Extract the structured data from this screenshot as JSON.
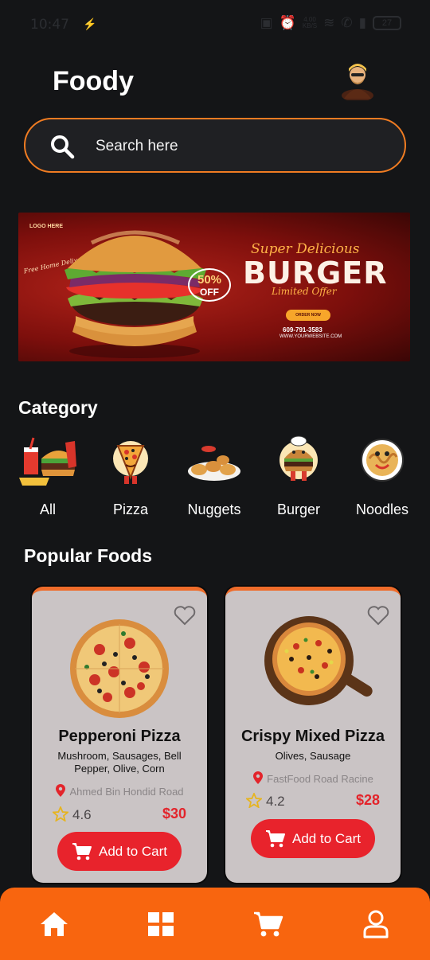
{
  "status_bar": {
    "time": "10:47",
    "speed": "4.00\nKB/S",
    "battery": "27"
  },
  "header": {
    "title": "Foody"
  },
  "search": {
    "placeholder": "Search here"
  },
  "banner": {
    "logo": "LOGO HERE",
    "free_delivery": "Free Home Delivery",
    "discount_pct": "50%",
    "discount_word": "OFF",
    "super": "Super Delicious",
    "headline": "BURGER",
    "subline": "Limited Offer",
    "cta": "ORDER NOW",
    "phone": "609-791-3583",
    "website": "WWW.YOURWEBSITE.COM"
  },
  "category": {
    "title": "Category",
    "items": [
      {
        "label": "All",
        "icon": "combo-meal-icon"
      },
      {
        "label": "Pizza",
        "icon": "pizza-mascot-icon"
      },
      {
        "label": "Nuggets",
        "icon": "nuggets-plate-icon"
      },
      {
        "label": "Burger",
        "icon": "burger-mascot-icon"
      },
      {
        "label": "Noodles",
        "icon": "noodles-mascot-icon"
      }
    ]
  },
  "popular": {
    "title": "Popular Foods",
    "foods": [
      {
        "name": "Pepperoni Pizza",
        "description": "Mushroom, Sausages, Bell Pepper, Olive, Corn",
        "location": "Ahmed Bin Hondid Road",
        "rating": "4.6",
        "price": "$30",
        "button": "Add to Cart"
      },
      {
        "name": "Crispy Mixed Pizza",
        "description": "Olives, Sausage",
        "location": "FastFood Road Racine",
        "rating": "4.2",
        "price": "$28",
        "button": "Add to Cart"
      }
    ]
  },
  "nav": {
    "items": [
      "home-icon",
      "grid-icon",
      "cart-icon",
      "profile-icon"
    ]
  },
  "colors": {
    "accent": "#f8650f",
    "price": "#e3242b",
    "button": "#e8232c",
    "background": "#141517",
    "card": "#cac4c5"
  }
}
